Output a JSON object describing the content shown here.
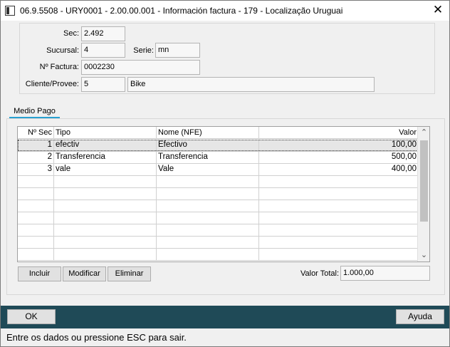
{
  "window": {
    "title": "06.9.5508 - URY0001 - 2.00.00.001 - Información factura - 179 - Localização Uruguai",
    "close_glyph": "✕"
  },
  "header": {
    "sec_label": "Sec:",
    "sec_value": "2.492",
    "sucursal_label": "Sucursal:",
    "sucursal_value": "4",
    "serie_label": "Serie:",
    "serie_value": "mn",
    "factura_label": "Nº Factura:",
    "factura_value": "0002230",
    "cliente_label": "Cliente/Provee:",
    "cliente_code": "5",
    "cliente_name": "Bike"
  },
  "tabs": [
    {
      "label": "Medio Pago",
      "active": true
    }
  ],
  "grid": {
    "columns": [
      "Nº Sec",
      "Tipo",
      "Nome (NFE)",
      "Valor"
    ],
    "rows": [
      {
        "sec": "1",
        "tipo": "efectiv",
        "nome": "Efectivo",
        "valor": "100,00"
      },
      {
        "sec": "2",
        "tipo": "Transferencia",
        "nome": "Transferencia",
        "valor": "500,00"
      },
      {
        "sec": "3",
        "tipo": "vale",
        "nome": "Vale",
        "valor": "400,00"
      }
    ],
    "scroll_up_glyph": "⌃",
    "scroll_down_glyph": "⌄"
  },
  "actions": {
    "incluir": "Incluir",
    "modificar": "Modificar",
    "eliminar": "Eliminar",
    "valor_total_label": "Valor Total:",
    "valor_total_value": "1.000,00"
  },
  "footer": {
    "ok": "OK",
    "ayuda": "Ayuda"
  },
  "status_text": "Entre os dados ou pressione ESC para sair.",
  "colors": {
    "footer_bar": "#1f4a57",
    "tab_accent": "#29a0d0",
    "selected_row": "#e6e6e6"
  }
}
